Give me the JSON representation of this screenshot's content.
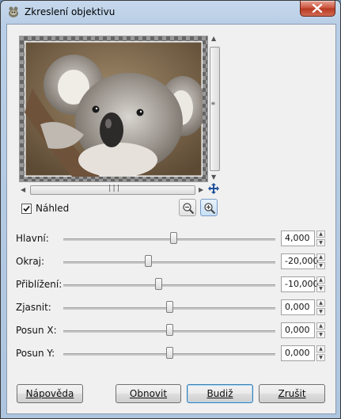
{
  "window": {
    "title": "Zkreslení objektivu"
  },
  "preview": {
    "checkbox_checked": true,
    "checkbox_label": "Náhled"
  },
  "sliders": [
    {
      "label": "Hlavní:",
      "value": "4,000",
      "fraction": 0.52
    },
    {
      "label": "Okraj:",
      "value": "-20,000",
      "fraction": 0.4
    },
    {
      "label": "Přiblížení:",
      "value": "-10,000",
      "fraction": 0.45
    },
    {
      "label": "Zjasnit:",
      "value": "0,000",
      "fraction": 0.5
    },
    {
      "label": "Posun X:",
      "value": "0,000",
      "fraction": 0.5
    },
    {
      "label": "Posun Y:",
      "value": "0,000",
      "fraction": 0.5
    }
  ],
  "buttons": {
    "help": "Nápověda",
    "reset": "Obnovit",
    "ok": "Budiž",
    "cancel": "Zrušit"
  },
  "colors": {
    "window_frame": "#b9cee6",
    "close": "#c9503a",
    "client": "#f0f0f0"
  }
}
